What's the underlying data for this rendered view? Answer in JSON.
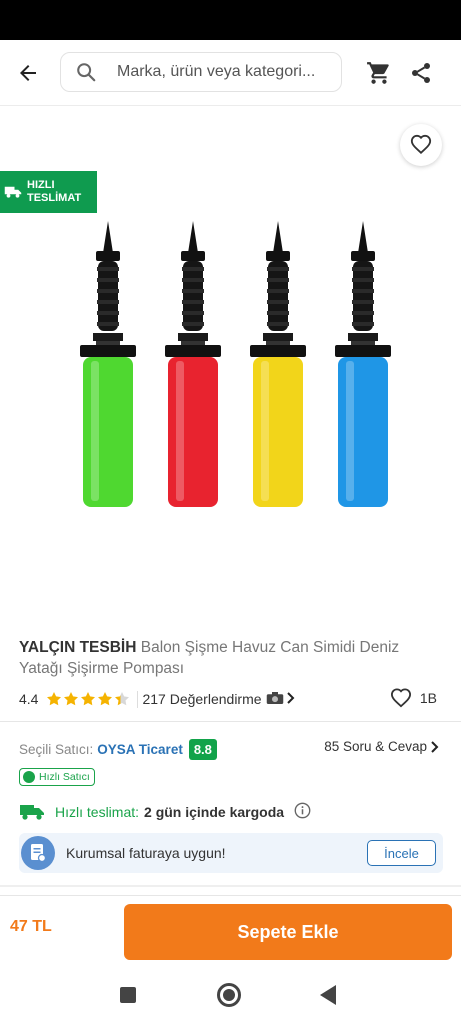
{
  "search": {
    "placeholder": "Marka, ürün veya kategori..."
  },
  "badge": {
    "fast_delivery": "HIZLI TESLİMAT"
  },
  "product": {
    "brand": "YALÇIN TESBİH",
    "name": "Balon Şişme Havuz Can Simidi Deniz Yatağı Şişirme Pompası",
    "rating": "4.4",
    "rating_value": 4.4,
    "reviews": "217 Değerlendirme",
    "likes": "1B",
    "pump_colors": [
      "#4fd830",
      "#e8232f",
      "#f2d51a",
      "#1f96e6"
    ]
  },
  "seller": {
    "label": "Seçili Satıcı:",
    "name": "OYSA Ticaret",
    "score": "8.8",
    "qa": "85 Soru & Cevap",
    "fast_seller": "Hızlı Satıcı"
  },
  "delivery": {
    "label": "Hızlı teslimat:",
    "value": "2 gün içinde kargoda"
  },
  "invoice": {
    "text": "Kurumsal faturaya uygun!",
    "button": "İncele"
  },
  "bottom": {
    "price": "47 TL",
    "add_to_cart": "Sepete Ekle"
  },
  "colors": {
    "accent": "#f27a1a",
    "green": "#0f9b4f",
    "link": "#2a72b5",
    "star": "#f5b301"
  }
}
